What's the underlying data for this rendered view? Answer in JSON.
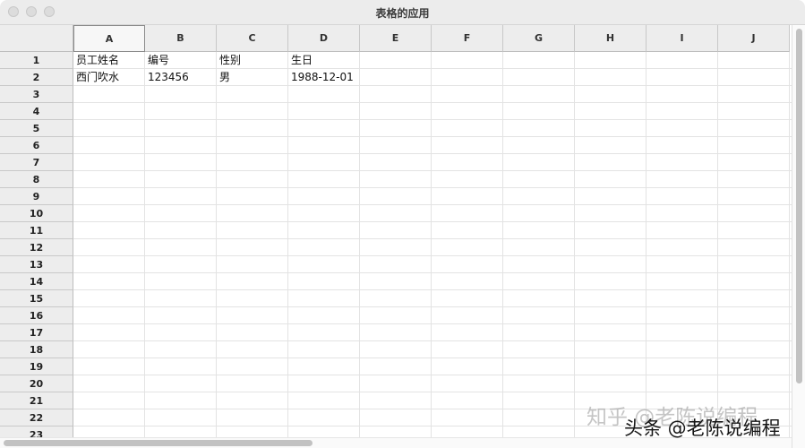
{
  "window": {
    "title": "表格的应用"
  },
  "columns": [
    "A",
    "B",
    "C",
    "D",
    "E",
    "F",
    "G",
    "H",
    "I",
    "J"
  ],
  "rows": [
    "1",
    "2",
    "3",
    "4",
    "5",
    "6",
    "7",
    "8",
    "9",
    "10",
    "11",
    "12",
    "13",
    "14",
    "15",
    "16",
    "17",
    "18",
    "19",
    "20",
    "21",
    "22",
    "23"
  ],
  "cells": [
    [
      "员工姓名",
      "编号",
      "性别",
      "生日"
    ],
    [
      "西门吹水",
      "123456",
      "男",
      "1988-12-01"
    ]
  ],
  "watermark": {
    "zhihu": "知乎 @老陈说编程",
    "toutiao": "头条 @老陈说编程"
  }
}
